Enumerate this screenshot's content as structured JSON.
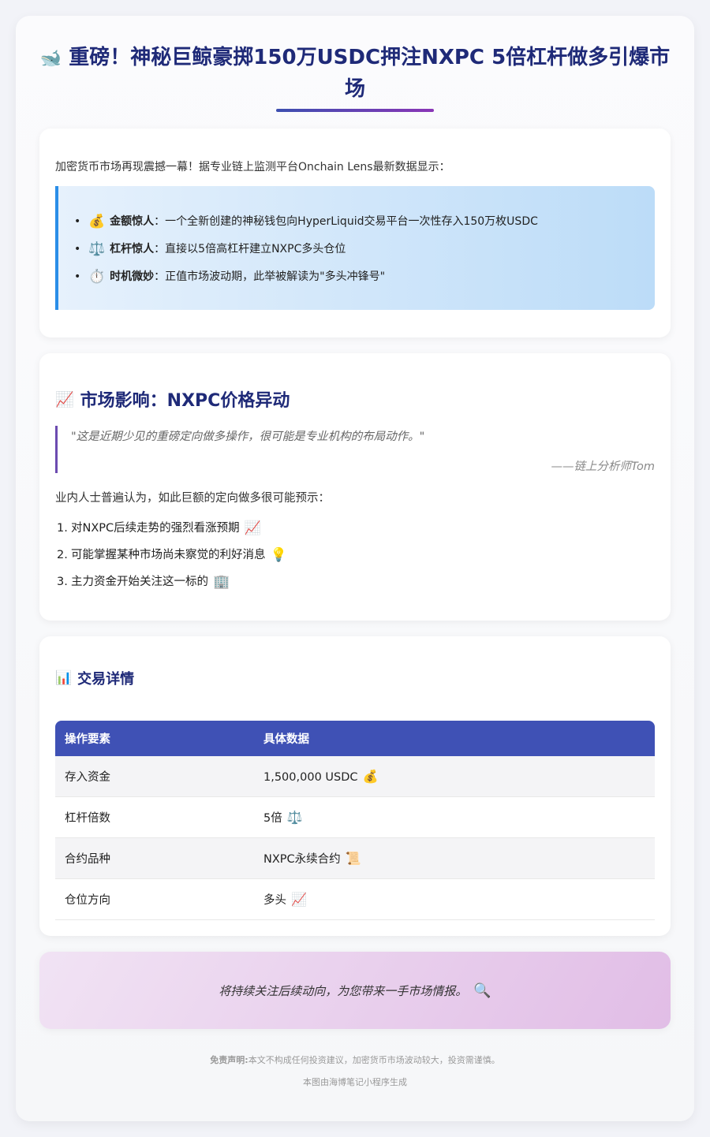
{
  "header": {
    "icon": "whale-icon",
    "emoji": "🐋",
    "title": "重磅！神秘巨鲸豪掷150万USDC押注NXPC 5倍杠杆做多引爆市场"
  },
  "intro": {
    "text": "加密货币市场再现震撼一幕！据专业链上监测平台Onchain Lens最新数据显示：",
    "items": [
      {
        "emoji": "💰",
        "icon": "money-bag-icon",
        "bold": "金额惊人",
        "text": "：一个全新创建的神秘钱包向HyperLiquid交易平台一次性存入150万枚USDC"
      },
      {
        "emoji": "⚖️",
        "icon": "balance-scale-icon",
        "bold": "杠杆惊人",
        "text": "：直接以5倍高杠杆建立NXPC多头仓位"
      },
      {
        "emoji": "⏱️",
        "icon": "stopwatch-icon",
        "bold": "时机微妙",
        "text": "：正值市场波动期，此举被解读为\"多头冲锋号\""
      }
    ]
  },
  "impact": {
    "emoji": "📈",
    "icon": "chart-up-icon",
    "heading": "市场影响：NXPC价格异动",
    "quote": "\"这是近期少见的重磅定向做多操作，很可能是专业机构的布局动作。\"",
    "quote_source": "——链上分析师Tom",
    "lead": "业内人士普遍认为，如此巨额的定向做多很可能预示：",
    "points": [
      {
        "num": "1.",
        "text": "对NXPC后续走势的强烈看涨预期",
        "emoji": "📈",
        "icon": "chart-up-icon"
      },
      {
        "num": "2.",
        "text": "可能掌握某种市场尚未察觉的利好消息",
        "emoji": "💡",
        "icon": "light-bulb-icon"
      },
      {
        "num": "3.",
        "text": "主力资金开始关注这一标的",
        "emoji": "🏢",
        "icon": "office-building-icon"
      }
    ]
  },
  "trade": {
    "emoji": "📊",
    "icon": "bar-chart-icon",
    "heading": "交易详情",
    "columns": [
      "操作要素",
      "具体数据"
    ],
    "rows": [
      {
        "label": "存入资金",
        "value": "1,500,000 USDC",
        "emoji": "💰",
        "icon": "money-bag-icon"
      },
      {
        "label": "杠杆倍数",
        "value": "5倍",
        "emoji": "⚖️",
        "icon": "balance-scale-icon"
      },
      {
        "label": "合约品种",
        "value": "NXPC永续合约",
        "emoji": "📜",
        "icon": "scroll-icon"
      },
      {
        "label": "仓位方向",
        "value": "多头",
        "emoji": "📈",
        "icon": "chart-up-icon"
      }
    ]
  },
  "note": {
    "text": "将持续关注后续动向，为您带来一手市场情报。",
    "emoji": "🔍",
    "icon": "magnifier-icon"
  },
  "disclaimer": {
    "label": "免责声明:",
    "text": "本文不构成任何投资建议，加密货币市场波动较大，投资需谨慎。"
  },
  "footer": "本图由海博笔记小程序生成",
  "colors": {
    "title": "#1f2a78",
    "accent": "#3f51b5",
    "highlight_border": "#2a8ee8",
    "quote_border": "#6c4bb0"
  }
}
